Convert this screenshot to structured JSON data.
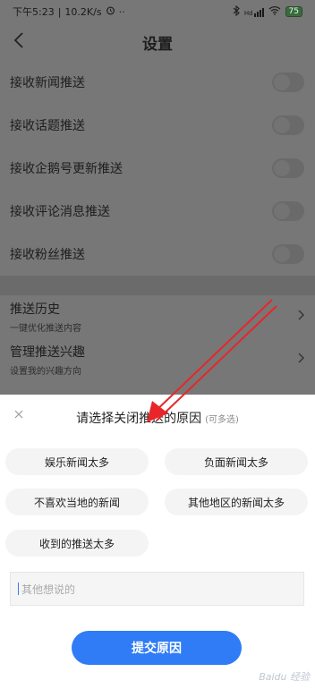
{
  "status_bar": {
    "time": "下午5:23",
    "speed": "10.2K/s",
    "alarm_icon": "alarm-icon",
    "dots": "··",
    "bluetooth_icon": "bluetooth-icon",
    "signal_label": "Hd",
    "wifi_icon": "wifi-icon",
    "battery": "75"
  },
  "header": {
    "back_icon": "chevron-left-icon",
    "title": "设置"
  },
  "settings": {
    "toggles": [
      {
        "label": "接收新闻推送",
        "on": false
      },
      {
        "label": "接收话题推送",
        "on": false
      },
      {
        "label": "接收企鹅号更新推送",
        "on": false
      },
      {
        "label": "接收评论消息推送",
        "on": false
      },
      {
        "label": "接收粉丝推送",
        "on": false
      }
    ],
    "nav_items": [
      {
        "title": "推送历史",
        "subtitle": "一键优化推送内容"
      },
      {
        "title": "管理推送兴趣",
        "subtitle": "设置我的兴趣方向"
      }
    ]
  },
  "sheet": {
    "close_icon": "close-icon",
    "title": "请选择关闭推送的原因",
    "hint": "(可多选)",
    "reasons": [
      "娱乐新闻太多",
      "负面新闻太多",
      "不喜欢当地的新闻",
      "其他地区的新闻太多",
      "收到的推送太多"
    ],
    "input_placeholder": "其他想说的",
    "submit_label": "提交原因"
  },
  "watermark": "Baidu 经验",
  "colors": {
    "accent": "#2f7cf6",
    "annotation": "#e8262a"
  }
}
